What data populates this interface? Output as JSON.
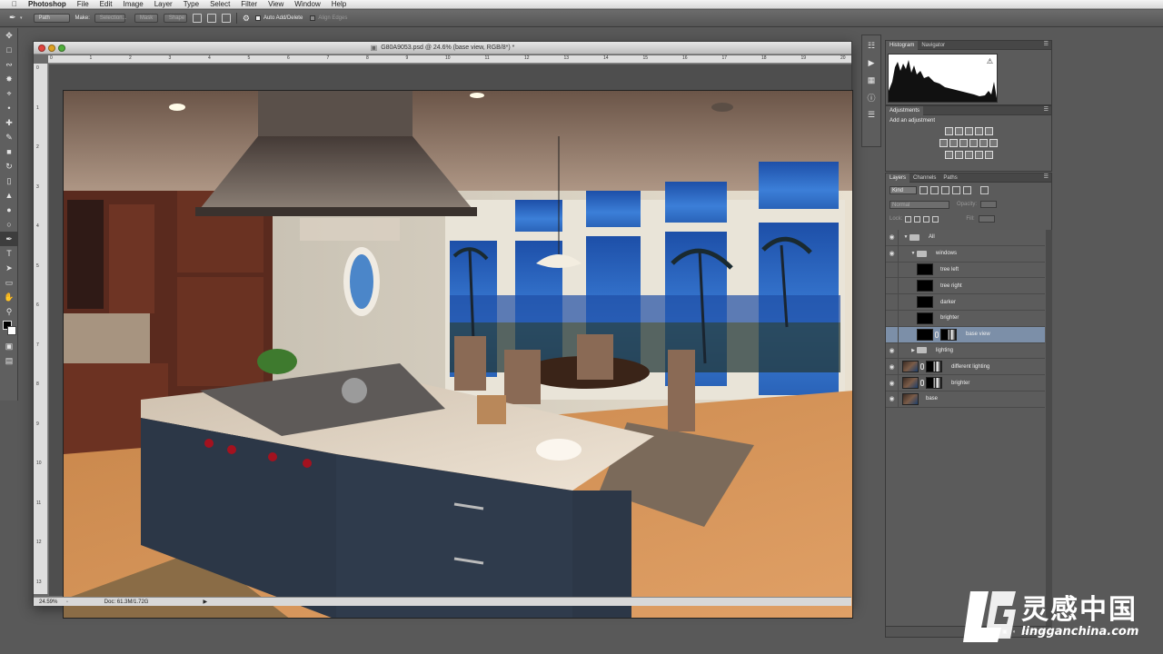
{
  "menubar": {
    "app": "Photoshop",
    "items": [
      "File",
      "Edit",
      "Image",
      "Layer",
      "Type",
      "Select",
      "Filter",
      "View",
      "Window",
      "Help"
    ]
  },
  "options_bar": {
    "mode": "Path",
    "make_label": "Make:",
    "selection_btn": "Selection...",
    "mask_btn": "Mask",
    "shape_btn": "Shape",
    "auto_add_delete": "Auto Add/Delete",
    "align_edges": "Align Edges"
  },
  "document": {
    "title": "G80A9053.psd @ 24.6% (base view, RGB/8*) *",
    "zoom": "24.59%",
    "doc_info": "Doc: 61.3M/1.72G",
    "ruler_top_labels": [
      "0",
      "1",
      "2",
      "3",
      "4",
      "5",
      "6",
      "7",
      "8",
      "9",
      "10",
      "11",
      "12",
      "13",
      "14",
      "15",
      "16",
      "17",
      "18",
      "19",
      "20"
    ],
    "ruler_left_labels": [
      "0",
      "1",
      "2",
      "3",
      "4",
      "5",
      "6",
      "7",
      "8",
      "9",
      "10",
      "11",
      "12",
      "13"
    ]
  },
  "panels": {
    "histogram_tabs": [
      "Histogram",
      "Navigator"
    ],
    "adjustments_tab": "Adjustments",
    "adjustments_title": "Add an adjustment",
    "layers_tabs": [
      "Layers",
      "Channels",
      "Paths"
    ],
    "kind": "Kind",
    "blend_mode": "Normal",
    "opacity_label": "Opacity:",
    "lock_label": "Lock:",
    "fill_label": "Fill:"
  },
  "layers": [
    {
      "name": "All",
      "type": "group",
      "depth": 0,
      "expanded": true,
      "visible": true
    },
    {
      "name": "windows",
      "type": "group",
      "depth": 1,
      "expanded": true,
      "visible": true
    },
    {
      "name": "tree left",
      "type": "layer",
      "depth": 2,
      "visible": false
    },
    {
      "name": "tree right",
      "type": "layer",
      "depth": 2,
      "visible": false
    },
    {
      "name": "darker",
      "type": "layer",
      "depth": 2,
      "visible": false
    },
    {
      "name": "brighter",
      "type": "layer",
      "depth": 2,
      "visible": false
    },
    {
      "name": "base view",
      "type": "layer",
      "depth": 2,
      "visible": false,
      "selected": true
    },
    {
      "name": "lighting",
      "type": "group",
      "depth": 1,
      "expanded": false,
      "visible": true
    },
    {
      "name": "different lighting",
      "type": "layer",
      "depth": 0,
      "visible": true
    },
    {
      "name": "brighter",
      "type": "layer",
      "depth": 0,
      "visible": true
    },
    {
      "name": "base",
      "type": "layer",
      "depth": 0,
      "visible": true
    }
  ],
  "watermark": {
    "chinese": "灵感中国",
    "url": "lingganchina.com"
  }
}
